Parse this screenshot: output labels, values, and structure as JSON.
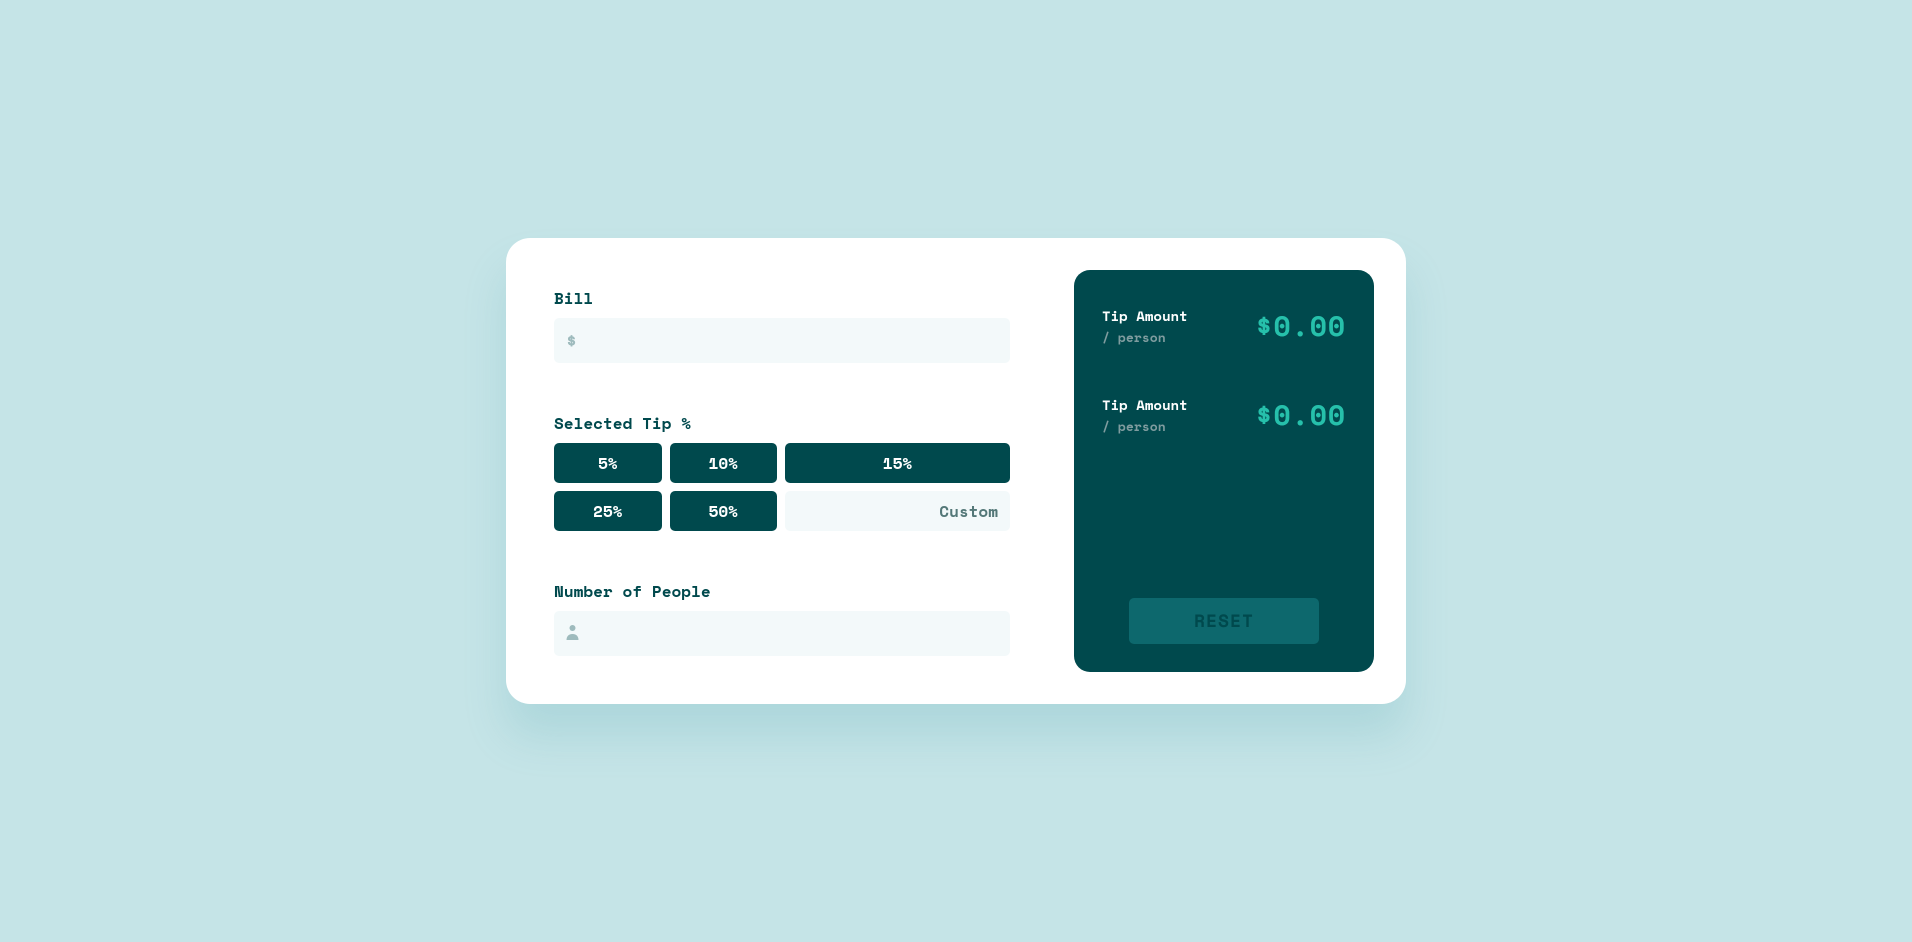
{
  "inputs": {
    "bill_label": "Bill",
    "bill_value": "",
    "bill_icon": "$",
    "tip_label": "Selected Tip %",
    "tip_options": [
      "5%",
      "10%",
      "15%",
      "25%",
      "50%"
    ],
    "tip_custom_placeholder": "Custom",
    "people_label": "Number of People",
    "people_value": ""
  },
  "results": {
    "tip": {
      "title": "Tip Amount",
      "sub": "/ person",
      "value": "$0.00"
    },
    "total": {
      "title": "Tip Amount",
      "sub": "/ person",
      "value": "$0.00"
    }
  },
  "reset_label": "RESET"
}
